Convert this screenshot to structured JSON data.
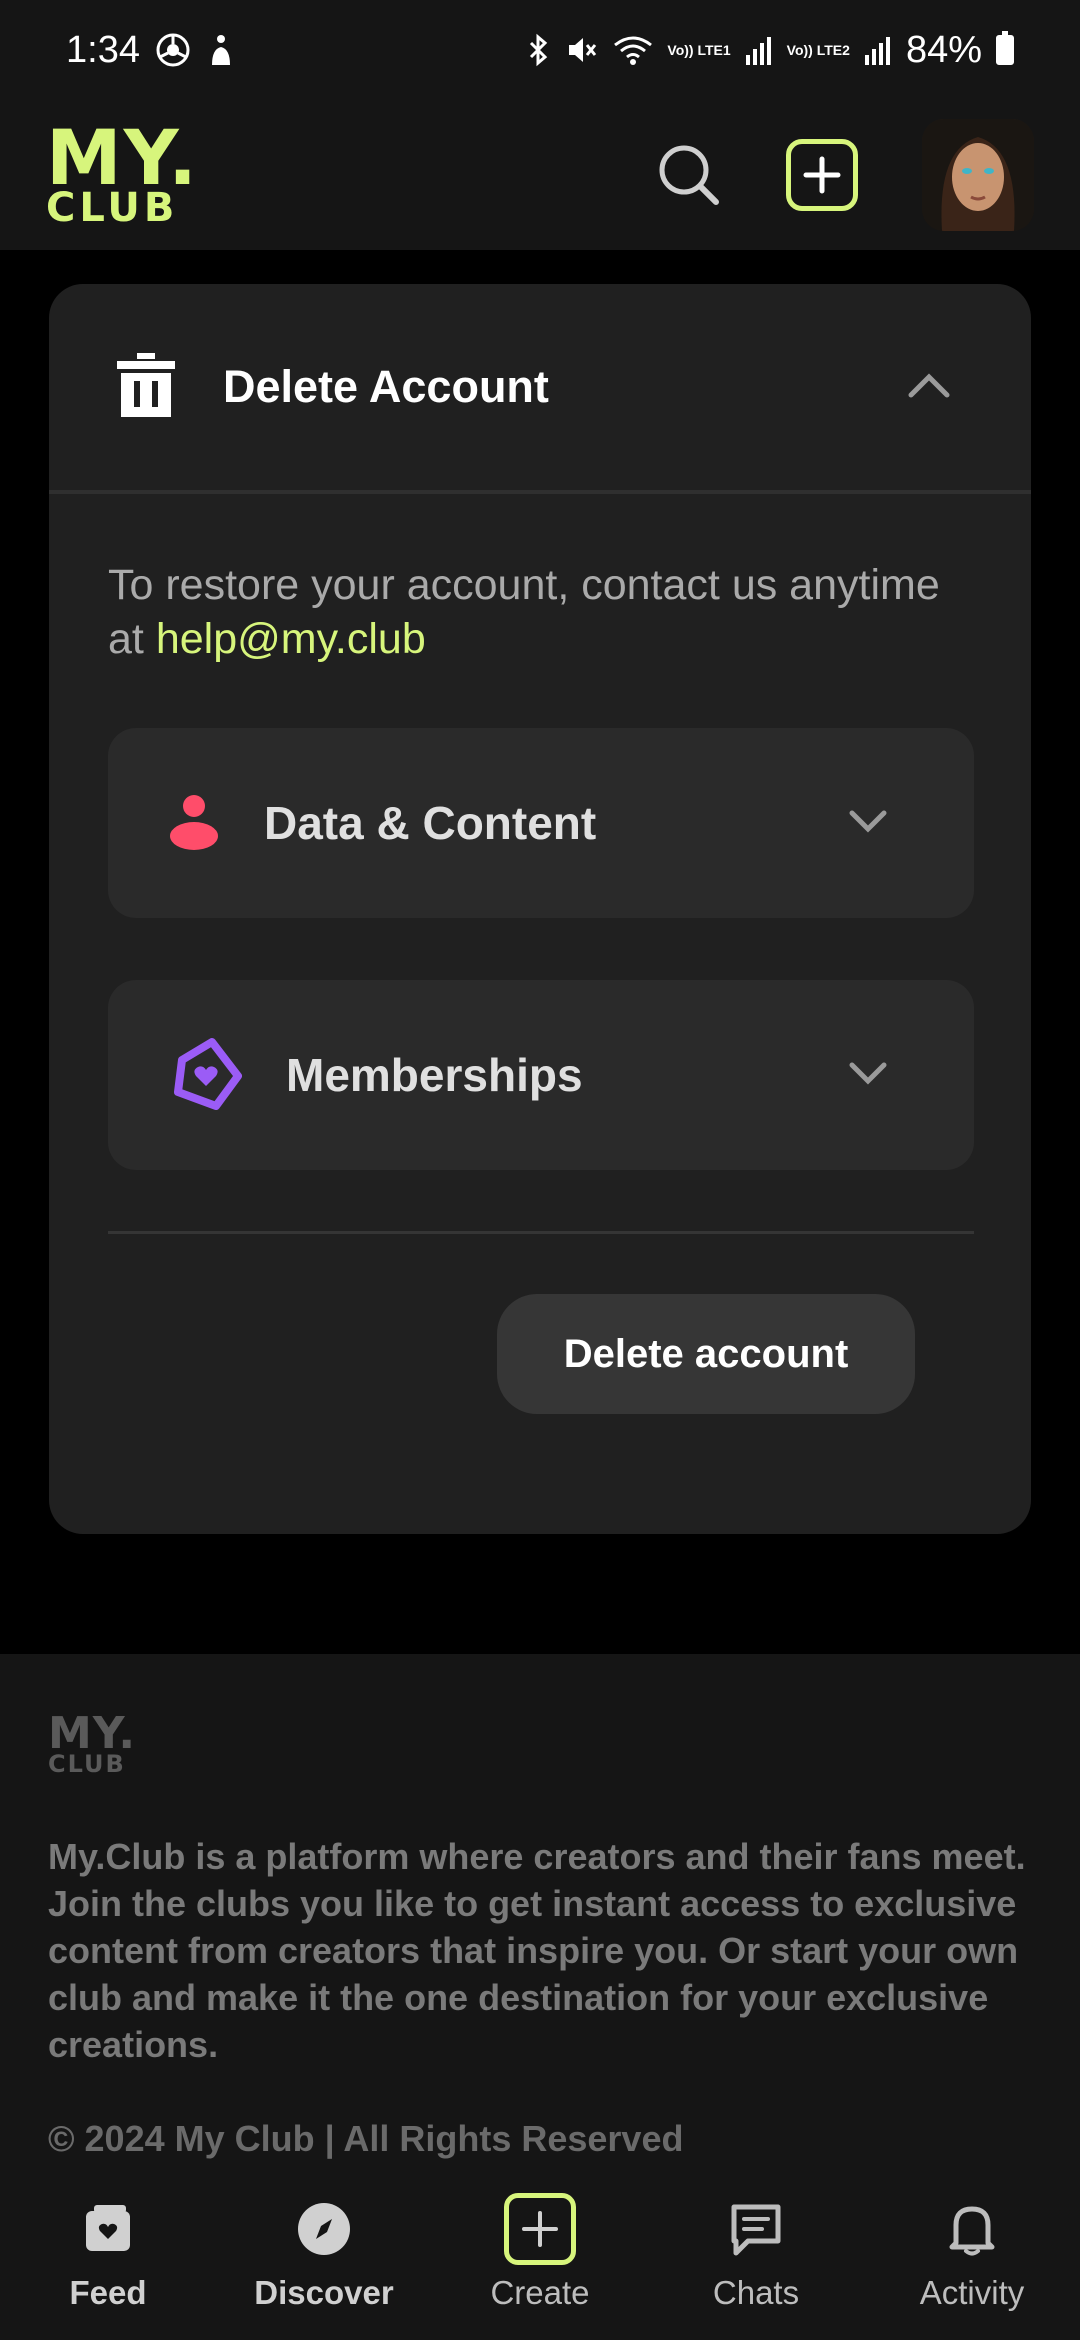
{
  "status_bar": {
    "time": "1:34",
    "battery": "84%",
    "network1": "Vo)) LTE1",
    "network2": "Vo)) LTE2"
  },
  "header": {
    "logo_top": "MY.",
    "logo_bottom": "CLUB",
    "accent_color": "#d7f57c"
  },
  "card": {
    "title": "Delete Account",
    "restore_text": "To restore your account, contact us anytime at",
    "email": "help@my.club",
    "sections": [
      {
        "label": "Data & Content",
        "icon": "person-icon"
      },
      {
        "label": "Memberships",
        "icon": "membership-heart-icon"
      }
    ],
    "delete_button": "Delete account"
  },
  "footer": {
    "logo_top": "MY.",
    "logo_bottom": "CLUB",
    "description": "My.Club is a platform where creators and their fans meet. Join the clubs you like to get instant access to exclusive content from creators that inspire you. Or start your own club and make it the one destination for your exclusive creations.",
    "copyright": "© 2024 My Club | All Rights Reserved"
  },
  "nav": {
    "items": [
      {
        "label": "Feed",
        "icon": "feed-icon"
      },
      {
        "label": "Discover",
        "icon": "compass-icon"
      },
      {
        "label": "Create",
        "icon": "plus-box-icon"
      },
      {
        "label": "Chats",
        "icon": "chat-icon"
      },
      {
        "label": "Activity",
        "icon": "bell-icon"
      }
    ]
  }
}
